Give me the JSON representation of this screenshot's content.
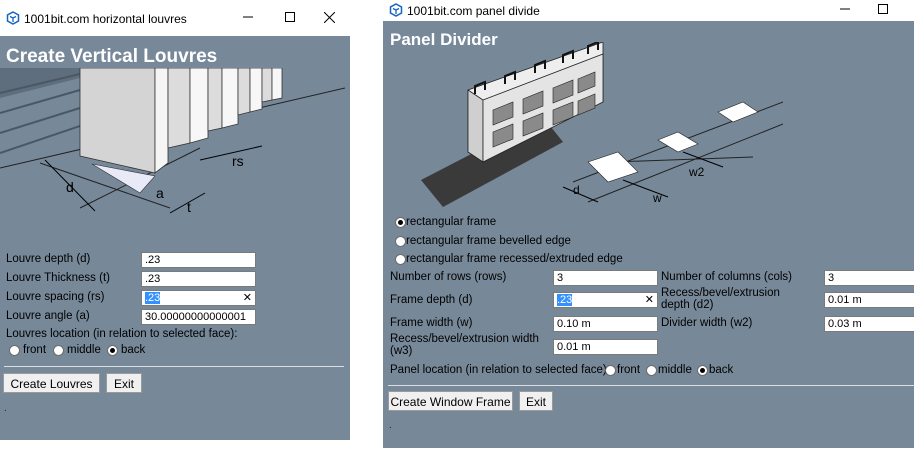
{
  "left_window": {
    "title": "1001bit.com horizontal louvres",
    "heading": "Create Vertical Louvres",
    "diagram_labels": {
      "rs": "rs",
      "d": "d",
      "a": "a",
      "t": "t"
    },
    "fields": [
      {
        "label": "Louvre depth (d)",
        "value": ".23"
      },
      {
        "label": "Louvre Thickness (t)",
        "value": ".23"
      },
      {
        "label": "Louvre spacing (rs)",
        "value": ".23"
      },
      {
        "label": "Louvre angle (a)",
        "value": "30.00000000000001"
      }
    ],
    "location_label": "Louvres location (in relation to selected face):",
    "location_options": [
      "front",
      "middle",
      "back"
    ],
    "location_selected": "back",
    "create_button": "Create Louvres",
    "exit_button": "Exit",
    "footer_text": "."
  },
  "right_window": {
    "title": "1001bit.com panel divide",
    "heading": "Panel Divider",
    "diagram_labels": {
      "d": "d",
      "w": "w",
      "w2": "w2"
    },
    "frame_options": [
      "rectangular frame",
      "rectangular frame bevelled edge",
      "rectangular frame recessed/extruded edge"
    ],
    "frame_selected": "rectangular frame",
    "fields": {
      "rows": {
        "label": "Number of rows (rows)",
        "value": "3"
      },
      "cols": {
        "label": "Number of columns (cols)",
        "value": "3"
      },
      "depth": {
        "label": "Frame depth (d)",
        "value": ".23"
      },
      "d2": {
        "label": "Recess/bevel/extrusion depth (d2)",
        "value": "0.01 m"
      },
      "width": {
        "label": "Frame width (w)",
        "value": "0.10 m"
      },
      "w2": {
        "label": "Divider width (w2)",
        "value": "0.03 m"
      },
      "w3": {
        "label": "Recess/bevel/extrusion width (w3)",
        "value": "0.01 m"
      }
    },
    "location_label": "Panel location (in relation to selected face):",
    "location_options": [
      "front",
      "middle",
      "back"
    ],
    "location_selected": "back",
    "create_button": "Create Window Frame",
    "exit_button": "Exit",
    "footer_text": "."
  },
  "colors": {
    "panel_bg": "#778899",
    "title_bg": "#ffffff",
    "selection": "#3390ff"
  },
  "icons": [
    "sketchup-logo-icon",
    "minimize-icon",
    "maximize-icon",
    "close-icon",
    "clear-icon"
  ]
}
